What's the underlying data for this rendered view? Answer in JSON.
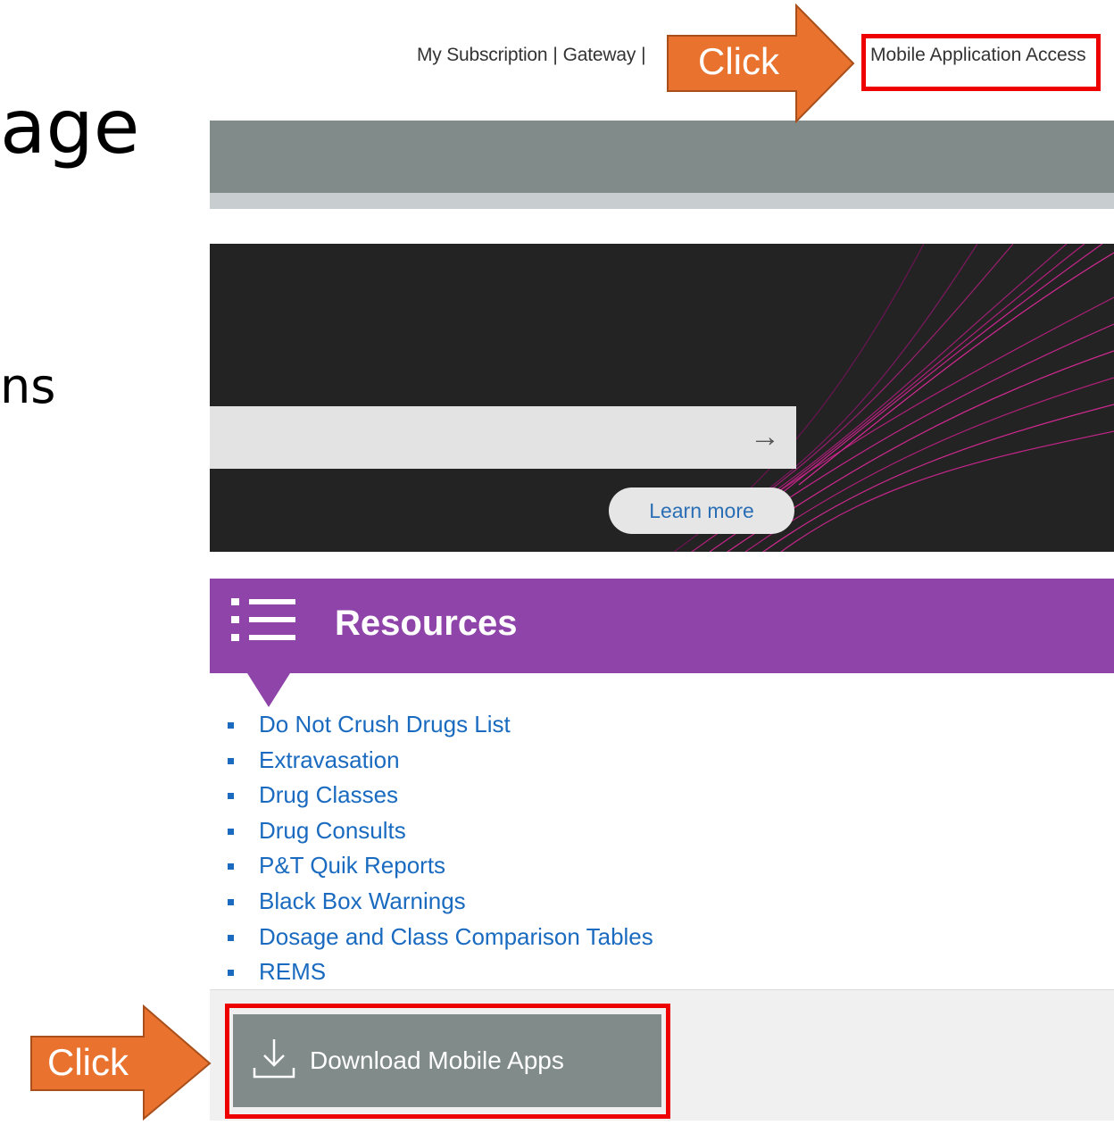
{
  "slide": {
    "title_fragment": "age",
    "text_fragment": "ns"
  },
  "topnav": {
    "items": [
      "My Subscription",
      "Gateway"
    ],
    "mobile_link": "Mobile Application Access"
  },
  "hero": {
    "learn_more": "Learn more"
  },
  "resources": {
    "title": "Resources",
    "links": [
      "Do Not Crush Drugs List",
      "Extravasation",
      "Drug Classes",
      "Drug Consults",
      "P&T Quik Reports",
      "Black Box Warnings",
      "Dosage and Class Comparison Tables",
      "REMS"
    ]
  },
  "download": {
    "label": "Download Mobile Apps"
  },
  "annotations": {
    "top_callout": "Click",
    "bottom_callout": "Click"
  },
  "colors": {
    "accent_purple": "#8e44a8",
    "link_blue": "#1a6bc0",
    "callout_orange": "#e8722e",
    "highlight_red": "#ee0000",
    "band_grey": "#808b8a"
  },
  "icons": [
    "arrow-right-icon",
    "list-icon",
    "download-icon"
  ]
}
